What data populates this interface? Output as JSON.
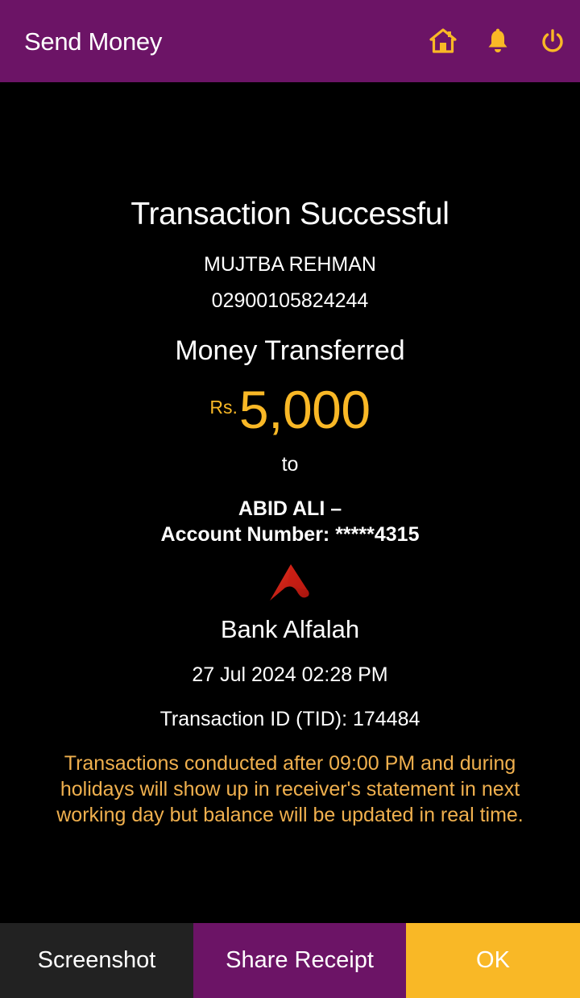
{
  "header": {
    "title": "Send Money",
    "icons": [
      "home-icon",
      "bell-icon",
      "power-icon"
    ],
    "icon_color": "#f9b826",
    "background": "#6c1466"
  },
  "receipt": {
    "status": "Transaction Successful",
    "sender_name": "MUJTBA REHMAN",
    "sender_account": "02900105824244",
    "money_label": "Money Transferred",
    "currency": "Rs.",
    "amount": "5,000",
    "to_label": "to",
    "recipient_name": "ABID ALI –",
    "recipient_account": "Account Number: *****4315",
    "bank_name": "Bank Alfalah",
    "datetime": "27 Jul 2024 02:28 PM",
    "transaction_id": "Transaction ID (TID): 174484",
    "notice": "Transactions conducted after 09:00 PM and during holidays will show up in receiver's statement in next working day but balance will be updated in real time."
  },
  "actions": {
    "screenshot_label": "Screenshot",
    "share_label": "Share Receipt",
    "ok_label": "OK"
  },
  "colors": {
    "accent": "#f9b826",
    "brand": "#6c1466",
    "notice": "#f0b04e"
  }
}
